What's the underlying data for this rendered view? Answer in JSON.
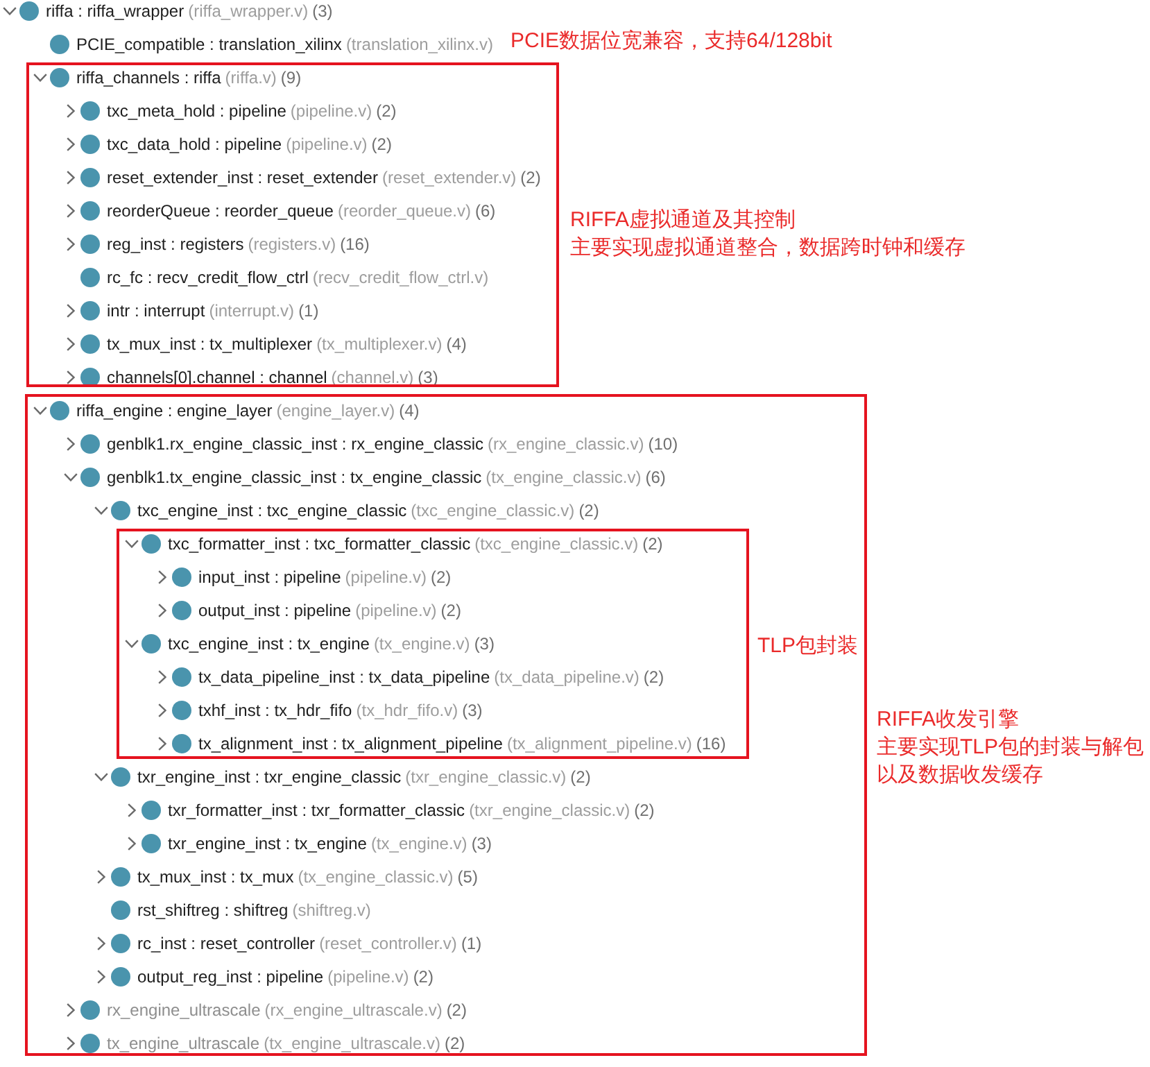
{
  "tree": [
    {
      "name": "riffa : riffa_wrapper",
      "file": "(riffa_wrapper.v)",
      "count": "(3)",
      "expanded": true,
      "greyed": false,
      "children": [
        {
          "name": "PCIE_compatible : translation_xilinx",
          "file": "(translation_xilinx.v)",
          "greyed": false
        },
        {
          "name": "riffa_channels : riffa",
          "file": "(riffa.v)",
          "count": "(9)",
          "expanded": true,
          "greyed": false,
          "children": [
            {
              "name": "txc_meta_hold : pipeline",
              "file": "(pipeline.v)",
              "count": "(2)",
              "expanded": false,
              "greyed": false
            },
            {
              "name": "txc_data_hold : pipeline",
              "file": "(pipeline.v)",
              "count": "(2)",
              "expanded": false,
              "greyed": false
            },
            {
              "name": "reset_extender_inst : reset_extender",
              "file": "(reset_extender.v)",
              "count": "(2)",
              "expanded": false,
              "greyed": false
            },
            {
              "name": "reorderQueue : reorder_queue",
              "file": "(reorder_queue.v)",
              "count": "(6)",
              "expanded": false,
              "greyed": false
            },
            {
              "name": "reg_inst : registers",
              "file": "(registers.v)",
              "count": "(16)",
              "expanded": false,
              "greyed": false
            },
            {
              "name": "rc_fc : recv_credit_flow_ctrl",
              "file": "(recv_credit_flow_ctrl.v)",
              "greyed": false
            },
            {
              "name": "intr : interrupt",
              "file": "(interrupt.v)",
              "count": "(1)",
              "expanded": false,
              "greyed": false
            },
            {
              "name": "tx_mux_inst : tx_multiplexer",
              "file": "(tx_multiplexer.v)",
              "count": "(4)",
              "expanded": false,
              "greyed": false
            },
            {
              "name": "channels[0].channel : channel",
              "file": "(channel.v)",
              "count": "(3)",
              "expanded": false,
              "greyed": false
            }
          ]
        },
        {
          "name": "riffa_engine : engine_layer",
          "file": "(engine_layer.v)",
          "count": "(4)",
          "expanded": true,
          "greyed": false,
          "children": [
            {
              "name": "genblk1.rx_engine_classic_inst : rx_engine_classic",
              "file": "(rx_engine_classic.v)",
              "count": "(10)",
              "expanded": false,
              "greyed": false
            },
            {
              "name": "genblk1.tx_engine_classic_inst : tx_engine_classic",
              "file": "(tx_engine_classic.v)",
              "count": "(6)",
              "expanded": true,
              "greyed": false,
              "children": [
                {
                  "name": "txc_engine_inst : txc_engine_classic",
                  "file": "(txc_engine_classic.v)",
                  "count": "(2)",
                  "expanded": true,
                  "greyed": false,
                  "children": [
                    {
                      "name": "txc_formatter_inst : txc_formatter_classic",
                      "file": "(txc_engine_classic.v)",
                      "count": "(2)",
                      "expanded": true,
                      "greyed": false,
                      "children": [
                        {
                          "name": "input_inst : pipeline",
                          "file": "(pipeline.v)",
                          "count": "(2)",
                          "expanded": false,
                          "greyed": false
                        },
                        {
                          "name": "output_inst : pipeline",
                          "file": "(pipeline.v)",
                          "count": "(2)",
                          "expanded": false,
                          "greyed": false
                        }
                      ]
                    },
                    {
                      "name": "txc_engine_inst : tx_engine",
                      "file": "(tx_engine.v)",
                      "count": "(3)",
                      "expanded": true,
                      "greyed": false,
                      "children": [
                        {
                          "name": "tx_data_pipeline_inst : tx_data_pipeline",
                          "file": "(tx_data_pipeline.v)",
                          "count": "(2)",
                          "expanded": false,
                          "greyed": false
                        },
                        {
                          "name": "txhf_inst : tx_hdr_fifo",
                          "file": "(tx_hdr_fifo.v)",
                          "count": "(3)",
                          "expanded": false,
                          "greyed": false
                        },
                        {
                          "name": "tx_alignment_inst : tx_alignment_pipeline",
                          "file": "(tx_alignment_pipeline.v)",
                          "count": "(16)",
                          "expanded": false,
                          "greyed": false
                        }
                      ]
                    }
                  ]
                },
                {
                  "name": "txr_engine_inst : txr_engine_classic",
                  "file": "(txr_engine_classic.v)",
                  "count": "(2)",
                  "expanded": true,
                  "greyed": false,
                  "children": [
                    {
                      "name": "txr_formatter_inst : txr_formatter_classic",
                      "file": "(txr_engine_classic.v)",
                      "count": "(2)",
                      "expanded": false,
                      "greyed": false
                    },
                    {
                      "name": "txr_engine_inst : tx_engine",
                      "file": "(tx_engine.v)",
                      "count": "(3)",
                      "expanded": false,
                      "greyed": false
                    }
                  ]
                },
                {
                  "name": "tx_mux_inst : tx_mux",
                  "file": "(tx_engine_classic.v)",
                  "count": "(5)",
                  "expanded": false,
                  "greyed": false
                },
                {
                  "name": "rst_shiftreg : shiftreg",
                  "file": "(shiftreg.v)",
                  "greyed": false
                },
                {
                  "name": "rc_inst : reset_controller",
                  "file": "(reset_controller.v)",
                  "count": "(1)",
                  "expanded": false,
                  "greyed": false
                },
                {
                  "name": "output_reg_inst : pipeline",
                  "file": "(pipeline.v)",
                  "count": "(2)",
                  "expanded": false,
                  "greyed": false
                }
              ]
            },
            {
              "name": "rx_engine_ultrascale",
              "file": "(rx_engine_ultrascale.v)",
              "count": "(2)",
              "expanded": false,
              "greyed": true
            },
            {
              "name": "tx_engine_ultrascale",
              "file": "(tx_engine_ultrascale.v)",
              "count": "(2)",
              "expanded": false,
              "greyed": true
            }
          ]
        }
      ]
    }
  ],
  "annotations": [
    {
      "lines": [
        "PCIE数据位宽兼容，支持64/128bit"
      ],
      "boxed": false
    },
    {
      "lines": [
        "RIFFA虚拟通道及其控制",
        "主要实现虚拟通道整合，数据跨时钟和缓存"
      ],
      "boxed": true
    },
    {
      "lines": [
        "TLP包封装"
      ],
      "boxed": true
    },
    {
      "lines": [
        "RIFFA收发引擎",
        "主要实现TLP包的封装与解包",
        "以及数据收发缓存"
      ],
      "boxed": true
    }
  ]
}
